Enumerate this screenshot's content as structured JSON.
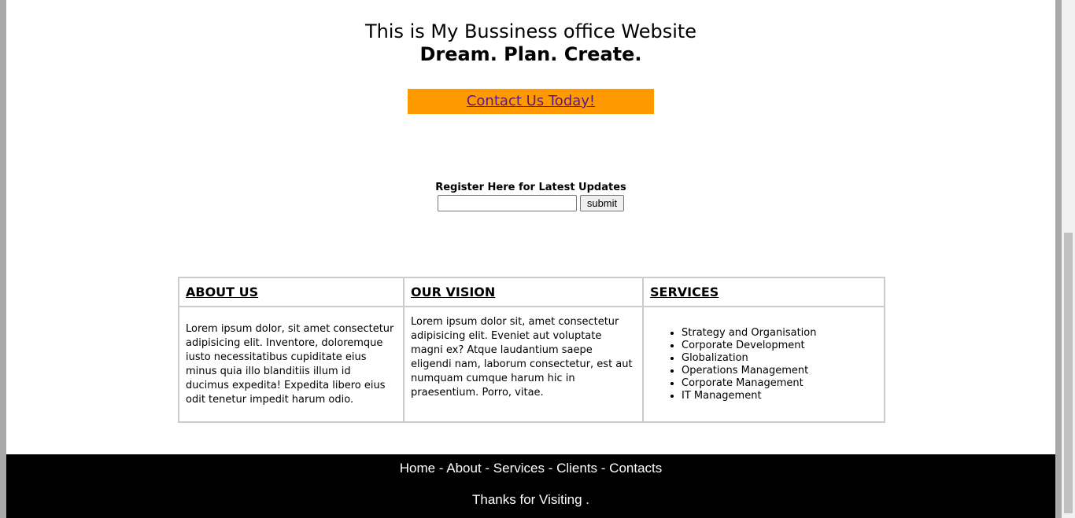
{
  "header": {
    "line1": "This is My Bussiness office Website",
    "line2": "Dream. Plan. Create."
  },
  "contact": {
    "label": "Contact Us Today!"
  },
  "register": {
    "label": "Register Here for Latest Updates",
    "input_value": "",
    "submit_label": "submit"
  },
  "table": {
    "headers": [
      "ABOUT US",
      "OUR VISION",
      "SERVICES"
    ],
    "about_text": "Lorem ipsum dolor, sit amet consectetur adipisicing elit. Inventore, doloremque iusto necessitatibus cupiditate eius minus quia illo blanditiis illum id ducimus expedita! Expedita libero eius odit tenetur impedit harum odio.",
    "vision_text": "Lorem ipsum dolor sit, amet consectetur adipisicing elit. Eveniet aut voluptate magni ex? Atque laudantium saepe eligendi nam, laborum consectetur, est aut numquam cumque harum hic in praesentium. Porro, vitae.",
    "services": [
      "Strategy and Organisation",
      "Corporate Development",
      "Globalization",
      "Operations Management",
      "Corporate Management",
      "IT Management"
    ]
  },
  "footer": {
    "nav": [
      "Home",
      "About",
      "Services",
      "Clients",
      "Contacts"
    ],
    "separator": " - ",
    "thanks": "Thanks for Visiting ."
  },
  "colors": {
    "accent": "#ff9900",
    "footer_bg": "#000000",
    "link_visited": "#551a8b"
  }
}
